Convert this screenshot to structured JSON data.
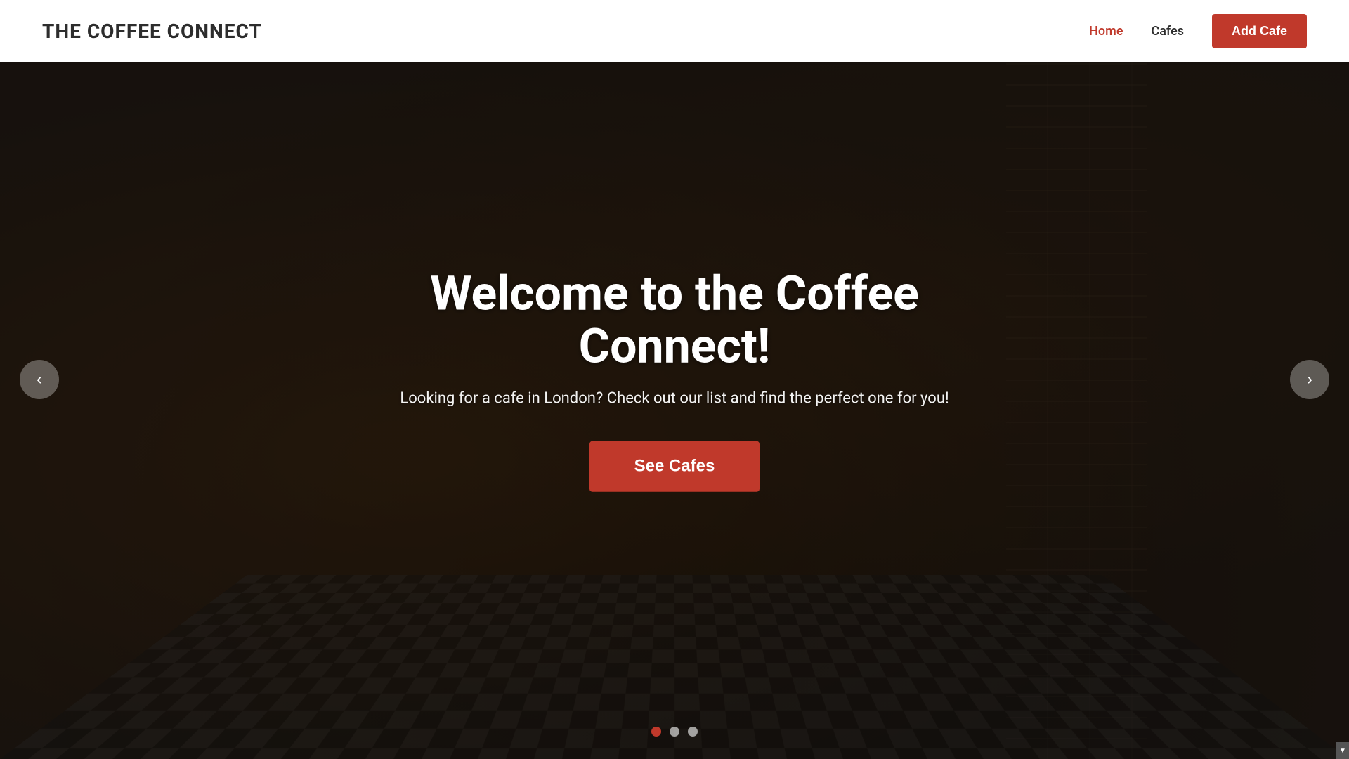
{
  "brand": {
    "name": "THE COFFEE CONNECT"
  },
  "navbar": {
    "links": [
      {
        "id": "home",
        "label": "Home",
        "active": true
      },
      {
        "id": "cafes",
        "label": "Cafes",
        "active": false
      }
    ],
    "add_cafe_button": "Add Cafe"
  },
  "hero": {
    "title": "Welcome to the Coffee Connect!",
    "subtitle": "Looking for a cafe in London? Check out our list and find the perfect one for you!",
    "cta_button": "See Cafes"
  },
  "carousel": {
    "prev_label": "‹",
    "next_label": "›",
    "dots": [
      {
        "id": 1,
        "active": true
      },
      {
        "id": 2,
        "active": false
      },
      {
        "id": 3,
        "active": false
      }
    ]
  },
  "scroll_indicator": "▼",
  "colors": {
    "brand_red": "#c0392b",
    "navbar_bg": "#ffffff",
    "text_dark": "#2d2d2d",
    "hero_text": "#ffffff"
  }
}
